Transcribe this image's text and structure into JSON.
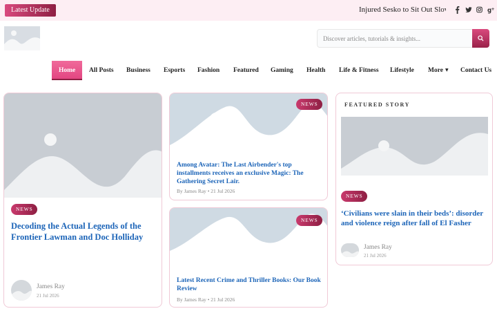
{
  "topbar": {
    "latest_label": "Latest Update",
    "ticker_text": "Injured Sesko to Sit Out Slovenia",
    "socials": [
      "f",
      "t",
      "ig",
      "g+"
    ]
  },
  "search": {
    "placeholder": "Discover articles, tutorials & insights..."
  },
  "nav": {
    "items": [
      "Home",
      "All Posts",
      "Business",
      "Esports",
      "Fashion",
      "Featured",
      "Gaming",
      "Health",
      "Life & Fitness",
      "Lifestyle",
      "More",
      "Contact Us"
    ],
    "active_index": 0
  },
  "colors": {
    "accent": "#e34682",
    "accent_dark": "#8e1f43",
    "link": "#1d65b8",
    "placeholder_bg": "#d8dde3"
  },
  "cards": {
    "main": {
      "badge": "NEWS",
      "title": "Decoding the Actual Legends of the Frontier Lawman and Doc Holliday",
      "author": "James Ray",
      "date": "21 Jul 2026"
    },
    "top_mid": {
      "badge": "NEWS",
      "title": "Among Avatar: The Last Airbender's top installments receives an exclusive Magic: The Gathering Secret Lair.",
      "meta": "By James Ray   • 21 Jul 2026"
    },
    "bottom_mid": {
      "badge": "NEWS",
      "title": "Latest Recent Crime and Thriller Books: Our Book Review",
      "meta": "By James Ray   • 21 Jul 2026"
    },
    "featured": {
      "label": "FEATURED STORY",
      "badge": "NEWS",
      "title": "‘Civilians were slain in their beds’: disorder and violence reign after fall of El Fasher",
      "author": "James Ray",
      "date": "21 Jul 2026"
    }
  }
}
